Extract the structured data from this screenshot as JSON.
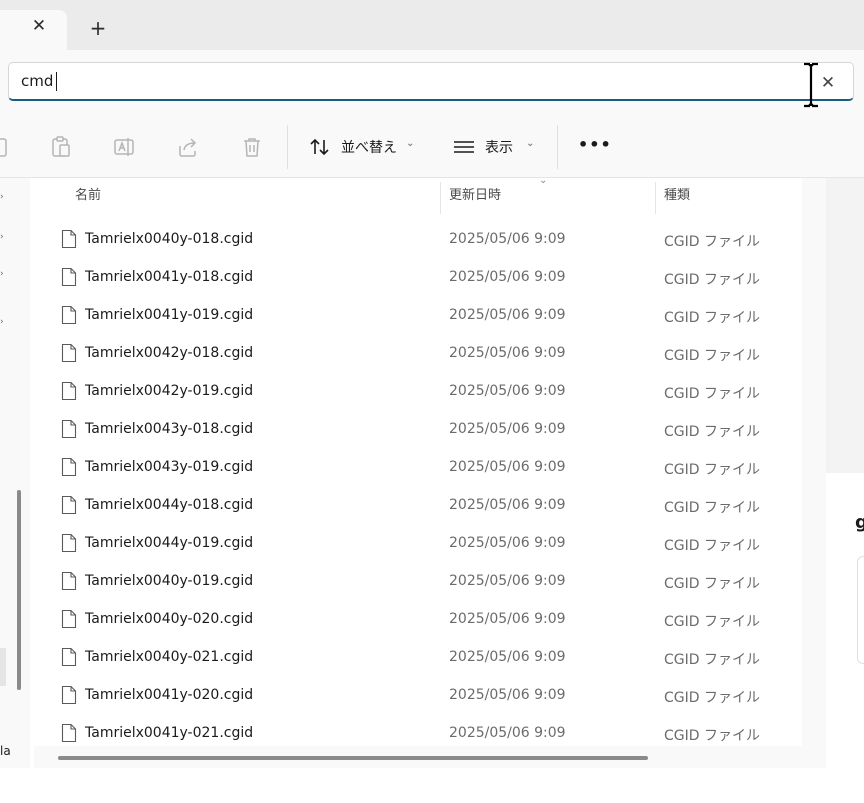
{
  "search": {
    "value": "cmd"
  },
  "toolbar": {
    "sort_label": "並べ替え",
    "view_label": "表示",
    "more_label": "•••"
  },
  "columns": {
    "name": "名前",
    "date": "更新日時",
    "type": "種類"
  },
  "files": [
    {
      "name": "Tamrielx0040y-018.cgid",
      "date": "2025/05/06 9:09",
      "type": "CGID ファイル"
    },
    {
      "name": "Tamrielx0041y-018.cgid",
      "date": "2025/05/06 9:09",
      "type": "CGID ファイル"
    },
    {
      "name": "Tamrielx0041y-019.cgid",
      "date": "2025/05/06 9:09",
      "type": "CGID ファイル"
    },
    {
      "name": "Tamrielx0042y-018.cgid",
      "date": "2025/05/06 9:09",
      "type": "CGID ファイル"
    },
    {
      "name": "Tamrielx0042y-019.cgid",
      "date": "2025/05/06 9:09",
      "type": "CGID ファイル"
    },
    {
      "name": "Tamrielx0043y-018.cgid",
      "date": "2025/05/06 9:09",
      "type": "CGID ファイル"
    },
    {
      "name": "Tamrielx0043y-019.cgid",
      "date": "2025/05/06 9:09",
      "type": "CGID ファイル"
    },
    {
      "name": "Tamrielx0044y-018.cgid",
      "date": "2025/05/06 9:09",
      "type": "CGID ファイル"
    },
    {
      "name": "Tamrielx0044y-019.cgid",
      "date": "2025/05/06 9:09",
      "type": "CGID ファイル"
    },
    {
      "name": "Tamrielx0040y-019.cgid",
      "date": "2025/05/06 9:09",
      "type": "CGID ファイル"
    },
    {
      "name": "Tamrielx0040y-020.cgid",
      "date": "2025/05/06 9:09",
      "type": "CGID ファイル"
    },
    {
      "name": "Tamrielx0040y-021.cgid",
      "date": "2025/05/06 9:09",
      "type": "CGID ファイル"
    },
    {
      "name": "Tamrielx0041y-020.cgid",
      "date": "2025/05/06 9:09",
      "type": "CGID ファイル"
    },
    {
      "name": "Tamrielx0041y-021.cgid",
      "date": "2025/05/06 9:09",
      "type": "CGID ファイル"
    }
  ],
  "nav": {
    "partial_text": "la"
  },
  "details": {
    "partial_char": "g"
  },
  "colors": {
    "accent": "#1c5b80",
    "background": "#f9f9f9",
    "muted_text": "#6b6b6b"
  }
}
